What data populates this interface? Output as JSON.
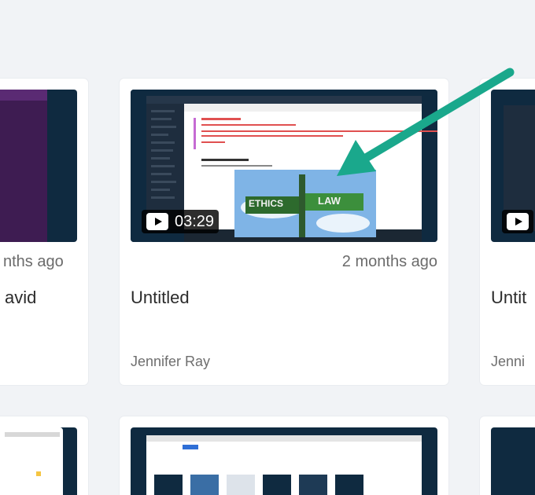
{
  "cards": {
    "left": {
      "ago": "nths ago",
      "title": "avid"
    },
    "center": {
      "duration": "03:29",
      "ago": "2 months ago",
      "title": "Untitled",
      "author": "Jennifer Ray",
      "thumb_sign_left": "ETHICS",
      "thumb_sign_right": "LAW"
    },
    "right": {
      "title": "Untit",
      "author": "Jenni"
    }
  },
  "colors": {
    "page_bg": "#f1f3f6",
    "thumb_bg": "#0f2a40",
    "arrow": "#1aa88c"
  },
  "icons": {
    "play": "play-icon",
    "arrow": "arrow-annotation"
  }
}
